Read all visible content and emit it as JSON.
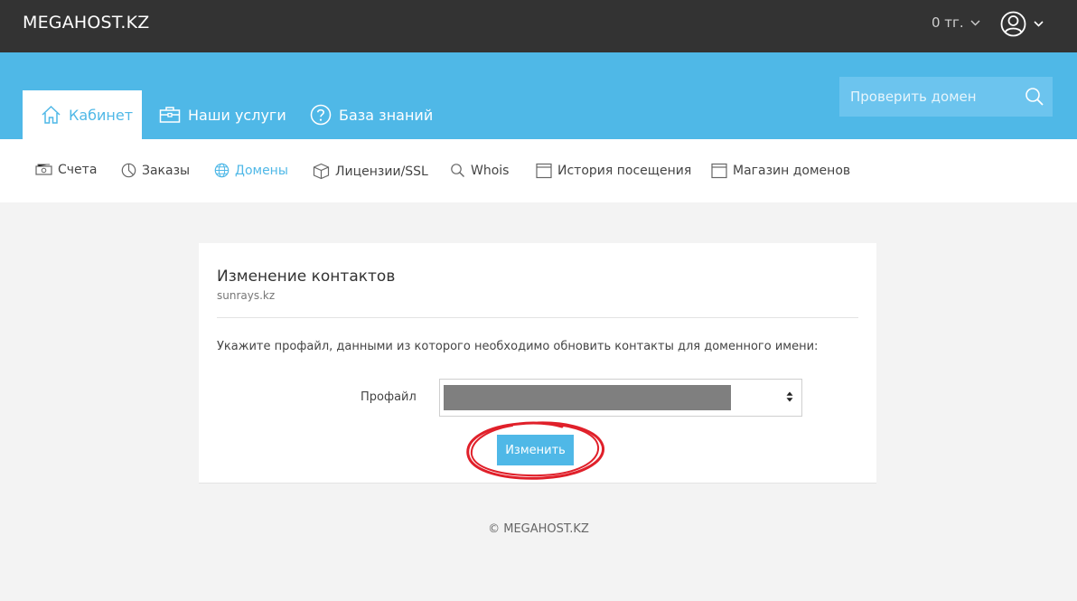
{
  "header": {
    "logo": "MEGAHOST.KZ",
    "balance": "0 тг."
  },
  "main_tabs": [
    {
      "label": "Кабинет",
      "icon": "home-icon",
      "active": true
    },
    {
      "label": "Наши услуги",
      "icon": "briefcase-icon",
      "active": false
    },
    {
      "label": "База знаний",
      "icon": "help-icon",
      "active": false
    }
  ],
  "search": {
    "placeholder": "Проверить домен"
  },
  "subnav": [
    {
      "label": "Счета",
      "icon": "money-icon"
    },
    {
      "label": "Заказы",
      "icon": "pie-chart-icon"
    },
    {
      "label": "Домены",
      "icon": "globe-icon",
      "active": true
    },
    {
      "label": "Лицензии/SSL",
      "icon": "box-icon"
    },
    {
      "label": "Whois",
      "icon": "search-icon"
    },
    {
      "label": "История посещения",
      "icon": "calendar-icon"
    },
    {
      "label": "Магазин доменов",
      "icon": "calendar-icon"
    }
  ],
  "card": {
    "title": "Изменение контактов",
    "domain": "sunrays.kz",
    "instruction": "Укажите профайл, данными из которого необходимо обновить контакты для доменного имени:",
    "profile_label": "Профайл",
    "submit_label": "Изменить"
  },
  "footer": {
    "text": "© MEGAHOST.KZ"
  },
  "colors": {
    "accent": "#4fb8e7",
    "topbar": "#333333",
    "highlight_circle": "#e0202a"
  }
}
